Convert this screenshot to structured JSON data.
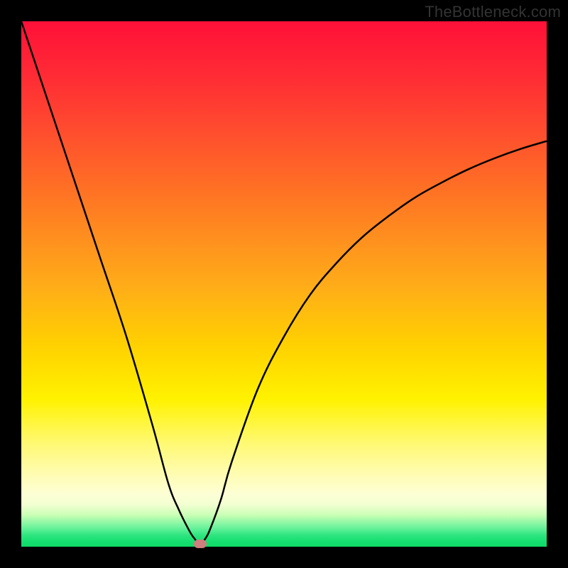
{
  "watermark": "TheBottleneck.com",
  "colors": {
    "frame": "#000000",
    "curve": "#000000",
    "dot": "#cf7f7d",
    "gradient_top": "#ff1038",
    "gradient_bottom": "#0fd968"
  },
  "chart_data": {
    "type": "line",
    "title": "",
    "xlabel": "",
    "ylabel": "",
    "xlim": [
      0,
      100
    ],
    "ylim": [
      0,
      100
    ],
    "series": [
      {
        "name": "bottleneck-curve",
        "x": [
          0,
          5,
          10,
          15,
          20,
          25,
          28,
          30,
          32,
          33,
          34,
          35,
          36,
          38,
          40,
          45,
          50,
          55,
          60,
          65,
          70,
          75,
          80,
          85,
          90,
          95,
          100
        ],
        "y": [
          100,
          85,
          70,
          55,
          40,
          23,
          12,
          7,
          3,
          1.5,
          0.5,
          1.5,
          3.5,
          9,
          16,
          30,
          40,
          48,
          54,
          59,
          63,
          66.5,
          69.3,
          71.8,
          73.9,
          75.7,
          77.2
        ]
      }
    ],
    "annotations": [
      {
        "name": "optimum-dot",
        "x": 34,
        "y": 0.5
      }
    ],
    "gradient_bands": [
      {
        "color": "#ff1038",
        "stop": 0.0
      },
      {
        "color": "#ff6a26",
        "stop": 0.3
      },
      {
        "color": "#ffd200",
        "stop": 0.62
      },
      {
        "color": "#fff96f",
        "stop": 0.8
      },
      {
        "color": "#8cf7a5",
        "stop": 0.955
      },
      {
        "color": "#0fd968",
        "stop": 1.0
      }
    ]
  }
}
